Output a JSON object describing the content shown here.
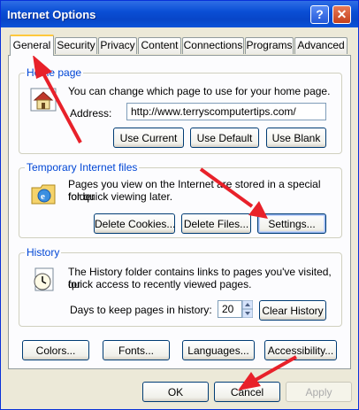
{
  "window": {
    "title": "Internet Options",
    "help_glyph": "?",
    "close_glyph": "✕"
  },
  "tabs": [
    {
      "label": "General"
    },
    {
      "label": "Security"
    },
    {
      "label": "Privacy"
    },
    {
      "label": "Content"
    },
    {
      "label": "Connections"
    },
    {
      "label": "Programs"
    },
    {
      "label": "Advanced"
    }
  ],
  "home_page": {
    "legend": "Home page",
    "description": "You can change which page to use for your home page.",
    "address_label": "Address:",
    "address_value": "http://www.terryscomputertips.com/",
    "buttons": {
      "use_current": "Use Current",
      "use_default": "Use Default",
      "use_blank": "Use Blank"
    }
  },
  "temp_files": {
    "legend": "Temporary Internet files",
    "description_line1": "Pages you view on the Internet are stored in a special folder",
    "description_line2": "for quick viewing later.",
    "buttons": {
      "delete_cookies": "Delete Cookies...",
      "delete_files": "Delete Files...",
      "settings": "Settings..."
    }
  },
  "history": {
    "legend": "History",
    "description_line1": "The History folder contains links to pages you've visited, for",
    "description_line2": "quick access to recently viewed pages.",
    "days_label": "Days to keep pages in history:",
    "days_value": "20",
    "clear_button": "Clear History"
  },
  "bottom_buttons": {
    "colors": "Colors...",
    "fonts": "Fonts...",
    "languages": "Languages...",
    "accessibility": "Accessibility..."
  },
  "dialog_buttons": {
    "ok": "OK",
    "cancel": "Cancel",
    "apply": "Apply"
  },
  "colors": {
    "titlebar": "#0a4fd5",
    "legend": "#0046d5",
    "annotation_arrow": "#e8212a",
    "active_tab_highlight": "#ffc83c"
  },
  "icons": {
    "home": "home-page-icon",
    "temp": "temporary-files-icon",
    "history": "history-icon"
  }
}
